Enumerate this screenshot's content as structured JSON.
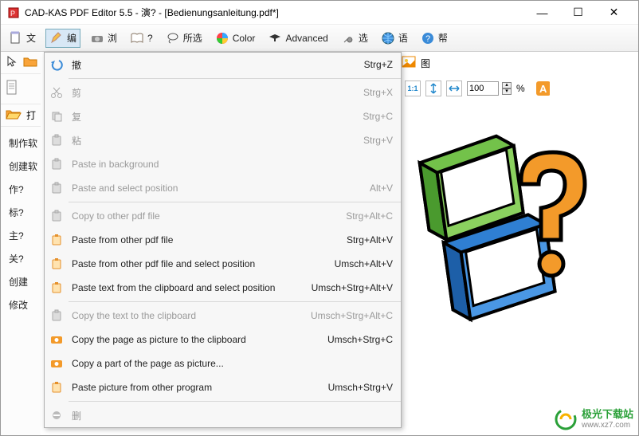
{
  "title": "CAD-KAS PDF Editor 5.5 - 演? - [Bedienungsanleitung.pdf*]",
  "winbtns": {
    "min": "—",
    "max": "☐",
    "close": "✕"
  },
  "toolbar": {
    "file": "文",
    "edit": "编",
    "view": "浏",
    "help": "?",
    "comment": "所选",
    "color": "Color",
    "advanced": "Advanced",
    "options": "选",
    "lang": "语",
    "helpq": "帮"
  },
  "rightcluster": {
    "tu": "图"
  },
  "zoom": {
    "value": "100",
    "pct": "%"
  },
  "sidebar_open": "打",
  "sidebar_items": [
    "制作软",
    "创建软",
    "作?",
    "标?",
    "主?",
    "关?",
    "创建",
    "修改"
  ],
  "menu": {
    "undo": {
      "label": "撤",
      "short": "Strg+Z"
    },
    "cut": {
      "label": "剪",
      "short": "Strg+X"
    },
    "copy": {
      "label": "复",
      "short": "Strg+C"
    },
    "paste": {
      "label": "粘",
      "short": "Strg+V"
    },
    "pastebg": {
      "label": "Paste in background",
      "short": ""
    },
    "pastepos": {
      "label": "Paste and select position",
      "short": "Alt+V"
    },
    "copyother": {
      "label": "Copy to other pdf file",
      "short": "Strg+Alt+C"
    },
    "pastefrom": {
      "label": "Paste from other pdf file",
      "short": "Strg+Alt+V"
    },
    "pastefrompos": {
      "label": "Paste from other pdf file and select position",
      "short": "Umsch+Alt+V"
    },
    "pastetext": {
      "label": "Paste text from the clipboard and select position",
      "short": "Umsch+Strg+Alt+V"
    },
    "copytext": {
      "label": "Copy the text to the clipboard",
      "short": "Umsch+Strg+Alt+C"
    },
    "copypage": {
      "label": "Copy the page as picture to the clipboard",
      "short": "Umsch+Strg+C"
    },
    "copypart": {
      "label": "Copy a part of the page as picture...",
      "short": ""
    },
    "pastepic": {
      "label": "Paste picture from other program",
      "short": "Umsch+Strg+V"
    },
    "del": {
      "label": "删",
      "short": ""
    }
  },
  "watermark": {
    "brand": "极光下载站",
    "url": "www.xz7.com"
  }
}
